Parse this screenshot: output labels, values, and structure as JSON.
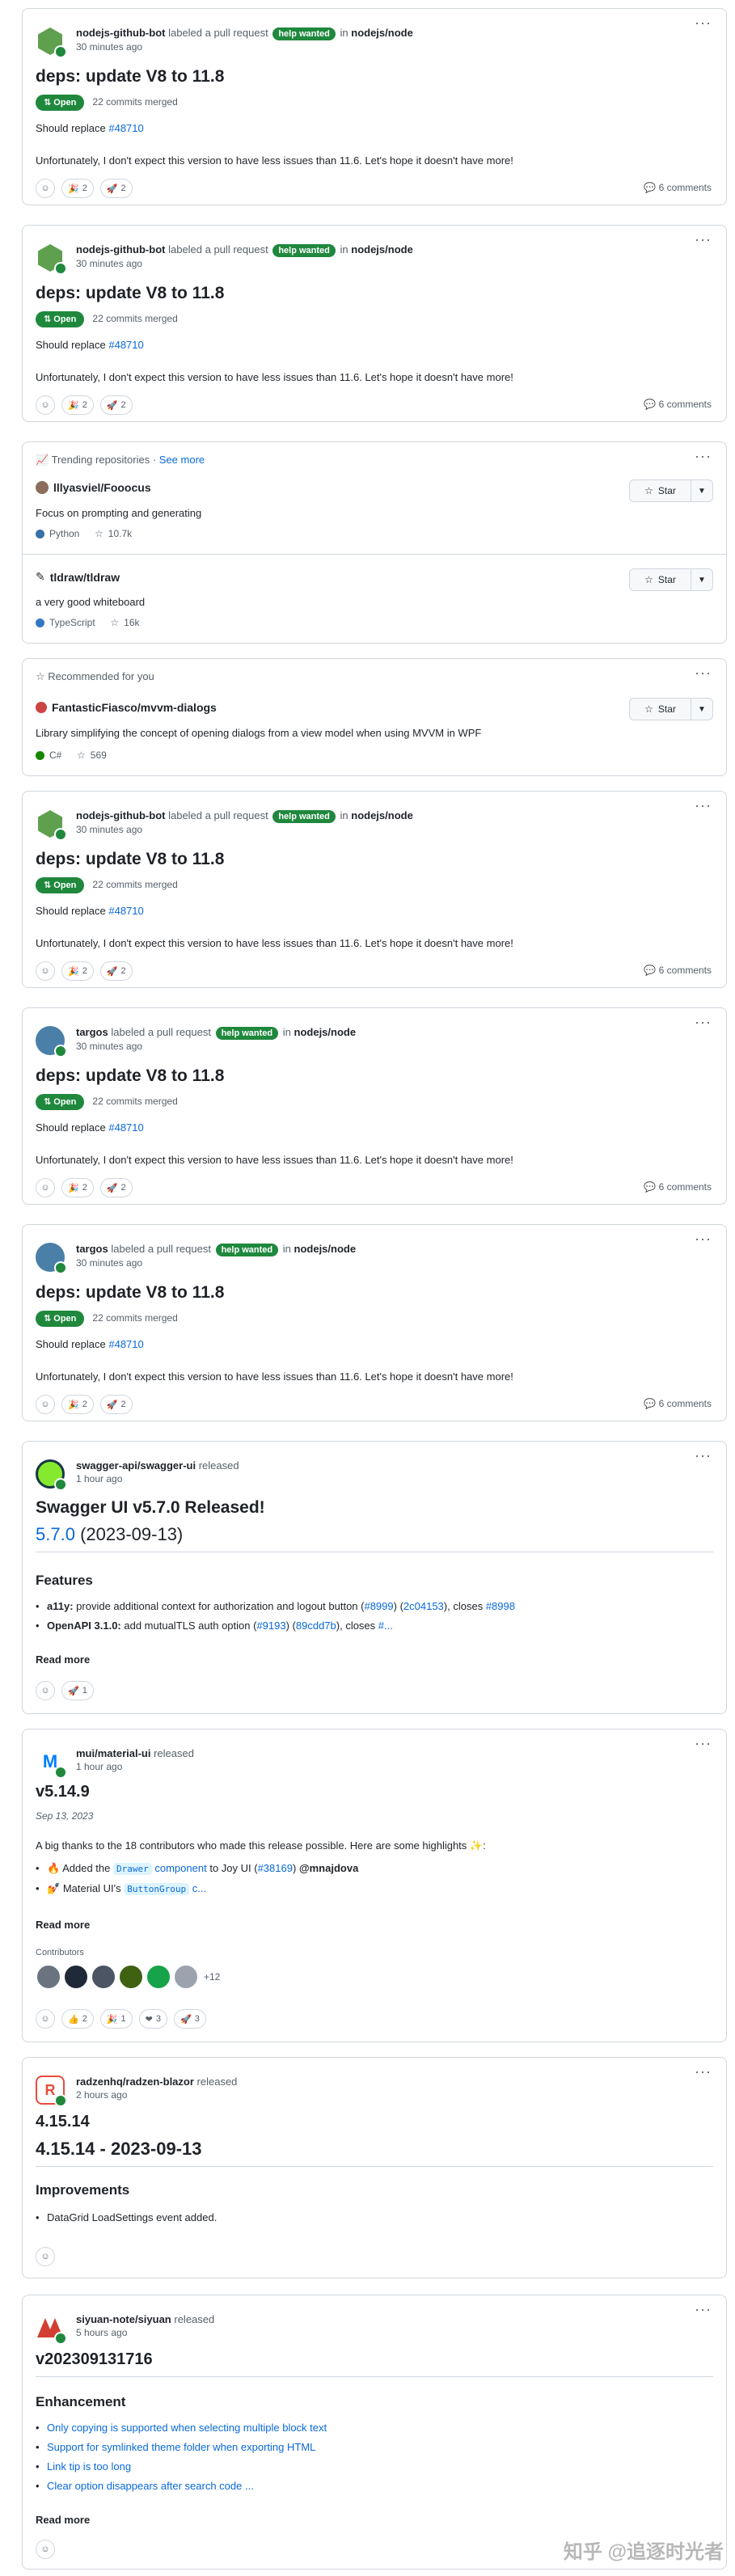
{
  "pr_cards": [
    {
      "actor": "nodejs-github-bot",
      "action": "labeled a pull request",
      "label": "help wanted",
      "in": "in",
      "repo": "nodejs/node",
      "time": "30 minutes ago",
      "title": "deps: update V8 to 11.8",
      "status": "Open",
      "commits": "22 commits merged",
      "replace_text": "Should replace",
      "replace_link": "#48710",
      "body": "Unfortunately, I don't expect this version to have less issues than 11.6. Let's hope it doesn't have more!",
      "r1": "2",
      "r2": "2",
      "comments": "6 comments"
    },
    {
      "actor": "nodejs-github-bot",
      "action": "labeled a pull request",
      "label": "help wanted",
      "in": "in",
      "repo": "nodejs/node",
      "time": "30 minutes ago",
      "title": "deps: update V8 to 11.8",
      "status": "Open",
      "commits": "22 commits merged",
      "replace_text": "Should replace",
      "replace_link": "#48710",
      "body": "Unfortunately, I don't expect this version to have less issues than 11.6. Let's hope it doesn't have more!",
      "r1": "2",
      "r2": "2",
      "comments": "6 comments"
    },
    {
      "actor": "nodejs-github-bot",
      "action": "labeled a pull request",
      "label": "help wanted",
      "in": "in",
      "repo": "nodejs/node",
      "time": "30 minutes ago",
      "title": "deps: update V8 to 11.8",
      "status": "Open",
      "commits": "22 commits merged",
      "replace_text": "Should replace",
      "replace_link": "#48710",
      "body": "Unfortunately, I don't expect this version to have less issues than 11.6. Let's hope it doesn't have more!",
      "r1": "2",
      "r2": "2",
      "comments": "6 comments"
    },
    {
      "actor": "targos",
      "action": "labeled a pull request",
      "label": "help wanted",
      "in": "in",
      "repo": "nodejs/node",
      "time": "30 minutes ago",
      "title": "deps: update V8 to 11.8",
      "status": "Open",
      "commits": "22 commits merged",
      "replace_text": "Should replace",
      "replace_link": "#48710",
      "body": "Unfortunately, I don't expect this version to have less issues than 11.6. Let's hope it doesn't have more!",
      "r1": "2",
      "r2": "2",
      "comments": "6 comments"
    },
    {
      "actor": "targos",
      "action": "labeled a pull request",
      "label": "help wanted",
      "in": "in",
      "repo": "nodejs/node",
      "time": "30 minutes ago",
      "title": "deps: update V8 to 11.8",
      "status": "Open",
      "commits": "22 commits merged",
      "replace_text": "Should replace",
      "replace_link": "#48710",
      "body": "Unfortunately, I don't expect this version to have less issues than 11.6. Let's hope it doesn't have more!",
      "r1": "2",
      "r2": "2",
      "comments": "6 comments"
    }
  ],
  "trending": {
    "heading": "Trending repositories",
    "see_more": "See more",
    "repos": [
      {
        "owner": "lllyasviel",
        "name": "Fooocus",
        "full": "lllyasviel/Fooocus",
        "desc": "Focus on prompting and generating",
        "lang": "Python",
        "stars": "10.7k"
      },
      {
        "owner": "tldraw",
        "name": "tldraw",
        "full": "tldraw/tldraw",
        "desc": "a very good whiteboard",
        "lang": "TypeScript",
        "stars": "16k"
      }
    ]
  },
  "recommended": {
    "heading": "Recommended for you",
    "repo": "FantasticFiasco/mvvm-dialogs",
    "desc": "Library simplifying the concept of opening dialogs from a view model when using MVVM in WPF",
    "lang": "C#",
    "stars": "569"
  },
  "star_label": "Star",
  "swagger": {
    "repo": "swagger-api/swagger-ui",
    "action": "released",
    "time": "1 hour ago",
    "title": "Swagger UI v5.7.0 Released!",
    "version_link": "5.7.0",
    "version_date": "(2023-09-13)",
    "features_heading": "Features",
    "f1_strong": "a11y:",
    "f1_text": "provide additional context for authorization and logout button (",
    "f1_l1": "#8999",
    "f1_sep": ") (",
    "f1_l2": "2c04153",
    "f1_end": "), closes ",
    "f1_l3": "#8998",
    "f2_strong": "OpenAPI 3.1.0:",
    "f2_text": "add mutualTLS auth option (",
    "f2_l1": "#9193",
    "f2_sep": ") (",
    "f2_l2": "89cdd7b",
    "f2_end": "), closes ",
    "f2_l3": "#...",
    "read_more": "Read more",
    "r1": "1"
  },
  "mui": {
    "repo": "mui/material-ui",
    "action": "released",
    "time": "1 hour ago",
    "title": "v5.14.9",
    "date": "Sep 13, 2023",
    "intro": "A big thanks to the 18 contributors who made this release possible. Here are some highlights ✨:",
    "b1_pre": "Added the",
    "b1_chip": "Drawer",
    "b1_link": "component",
    "b1_mid": "to Joy UI (",
    "b1_l2": "#38169",
    "b1_end": ")",
    "b1_user": "@mnajdova",
    "b2_pre": "Material UI's",
    "b2_chip": "ButtonGroup",
    "b2_end": "c...",
    "read_more": "Read more",
    "contributors": "Contributors",
    "more": "+12",
    "r1": "2",
    "r2": "1",
    "r3": "3",
    "r4": "3"
  },
  "radzen": {
    "repo": "radzenhq/radzen-blazor",
    "action": "released",
    "time": "2 hours ago",
    "title": "4.15.14",
    "subtitle": "4.15.14 - 2023-09-13",
    "improvements": "Improvements",
    "item": "DataGrid LoadSettings event added."
  },
  "siyuan": {
    "repo": "siyuan-note/siyuan",
    "action": "released",
    "time": "5 hours ago",
    "title": "v202309131716",
    "enh": "Enhancement",
    "items": [
      "Only copying is supported when selecting multiple block text",
      "Support for symlinked theme folder when exporting HTML",
      "Link tip is too long",
      "Clear option disappears after search code ..."
    ],
    "read_more": "Read more"
  },
  "watermark": "知乎 @追逐时光者",
  "kebab": "···"
}
